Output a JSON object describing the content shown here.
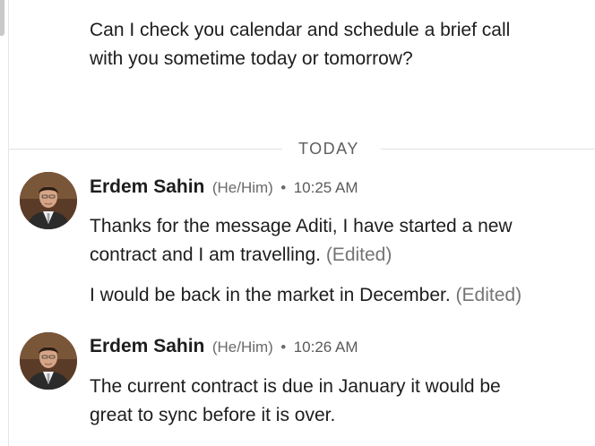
{
  "messages_top": {
    "line1": "Can I check you calendar and schedule a brief call",
    "line2": "with you sometime today or tomorrow?"
  },
  "divider": {
    "label": "TODAY"
  },
  "groups": [
    {
      "sender": "Erdem Sahin",
      "pronouns": "(He/Him)",
      "separator": "•",
      "time": "10:25 AM",
      "avatar_icon": "profile-photo",
      "messages": [
        {
          "line1": "Thanks for the message Aditi, I have started a new",
          "line2": "contract and I am travelling.",
          "edited": "(Edited)"
        },
        {
          "line1": "I would be back in the market in December.",
          "edited": "(Edited)"
        }
      ]
    },
    {
      "sender": "Erdem Sahin",
      "pronouns": "(He/Him)",
      "separator": "•",
      "time": "10:26 AM",
      "avatar_icon": "profile-photo",
      "messages": [
        {
          "line1": "The current contract is due in January it would be",
          "line2": "great to sync before it is over."
        }
      ]
    }
  ],
  "colors": {
    "text": "#1d1d1d",
    "muted": "#747474",
    "divider": "#e2e2e2"
  }
}
